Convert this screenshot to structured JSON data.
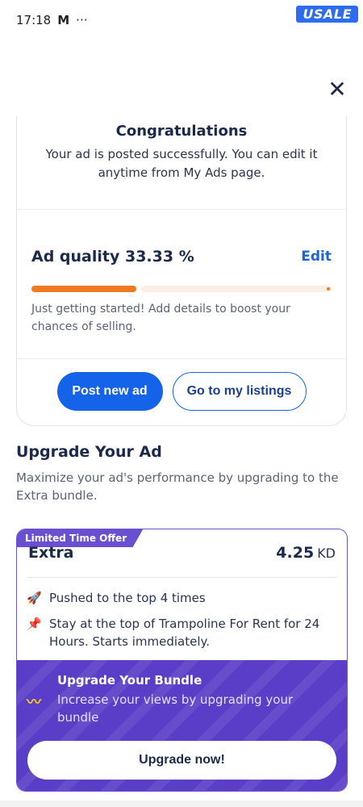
{
  "status_bar": {
    "time": "17:18",
    "mail_icon": "M",
    "more": "···",
    "badge": "USALE"
  },
  "congrats": {
    "title": "Congratulations",
    "message": "Your ad is posted successfully. You can edit it anytime from My Ads page."
  },
  "quality": {
    "title": "Ad quality 33.33 %",
    "edit_label": "Edit",
    "progress": 0.3333,
    "hint": "Just getting started! Add details to boost your chances of selling."
  },
  "actions": {
    "post_new": "Post new ad",
    "my_listings": "Go to my listings"
  },
  "upgrade": {
    "title": "Upgrade Your Ad",
    "description": "Maximize your ad's performance by upgrading to the Extra bundle."
  },
  "offer": {
    "ribbon": "Limited Time Offer",
    "name": "Extra",
    "price": "4.25",
    "currency": "KD",
    "features": [
      {
        "icon": "rocket-icon",
        "text": "Pushed to the top 4 times"
      },
      {
        "icon": "pin-icon",
        "text": "Stay at the top of Trampoline For Rent for 24 Hours. Starts immediately."
      }
    ]
  },
  "bundle": {
    "title": "Upgrade Your Bundle",
    "text": "Increase your views by upgrading your bundle",
    "button": "Upgrade now!"
  },
  "colors": {
    "primary": "#1463e8",
    "accent": "#f07a21",
    "purple": "#5a3ec8"
  }
}
